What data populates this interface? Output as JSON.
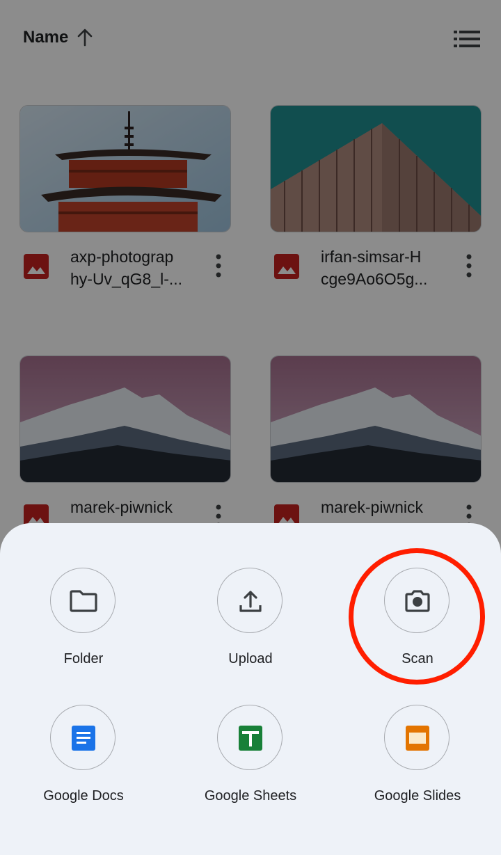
{
  "sort": {
    "label": "Name",
    "arrow_icon": "arrow-up-icon",
    "view_icon": "list-view-icon"
  },
  "files": [
    {
      "name": "axp-photography-Uv_qG8_l-...",
      "line1": "axp-photograp",
      "line2": "hy-Uv_qG8_l-...",
      "icon": "image-file-icon",
      "icon_color": "#c5221f"
    },
    {
      "name": "irfan-simsar-Hcge9Ao6O5g...",
      "line1": "irfan-simsar-H",
      "line2": "cge9Ao6O5g...",
      "icon": "image-file-icon",
      "icon_color": "#c5221f"
    },
    {
      "name": "marek-piwnick",
      "line1": "marek-piwnick",
      "line2": "",
      "icon": "image-file-icon",
      "icon_color": "#c5221f"
    },
    {
      "name": "marek-piwnick",
      "line1": "marek-piwnick",
      "line2": "",
      "icon": "image-file-icon",
      "icon_color": "#c5221f"
    }
  ],
  "sheet": {
    "actions": [
      {
        "label": "Folder",
        "icon": "folder-icon"
      },
      {
        "label": "Upload",
        "icon": "upload-icon"
      },
      {
        "label": "Scan",
        "icon": "camera-icon"
      },
      {
        "label": "Google Docs",
        "icon": "google-docs-icon",
        "color": "#1a73e8"
      },
      {
        "label": "Google Sheets",
        "icon": "google-sheets-icon",
        "color": "#188038"
      },
      {
        "label": "Google Slides",
        "icon": "google-slides-icon",
        "color": "#e37400"
      }
    ]
  },
  "highlight": {
    "target": "Scan",
    "color": "#ff1e00"
  }
}
